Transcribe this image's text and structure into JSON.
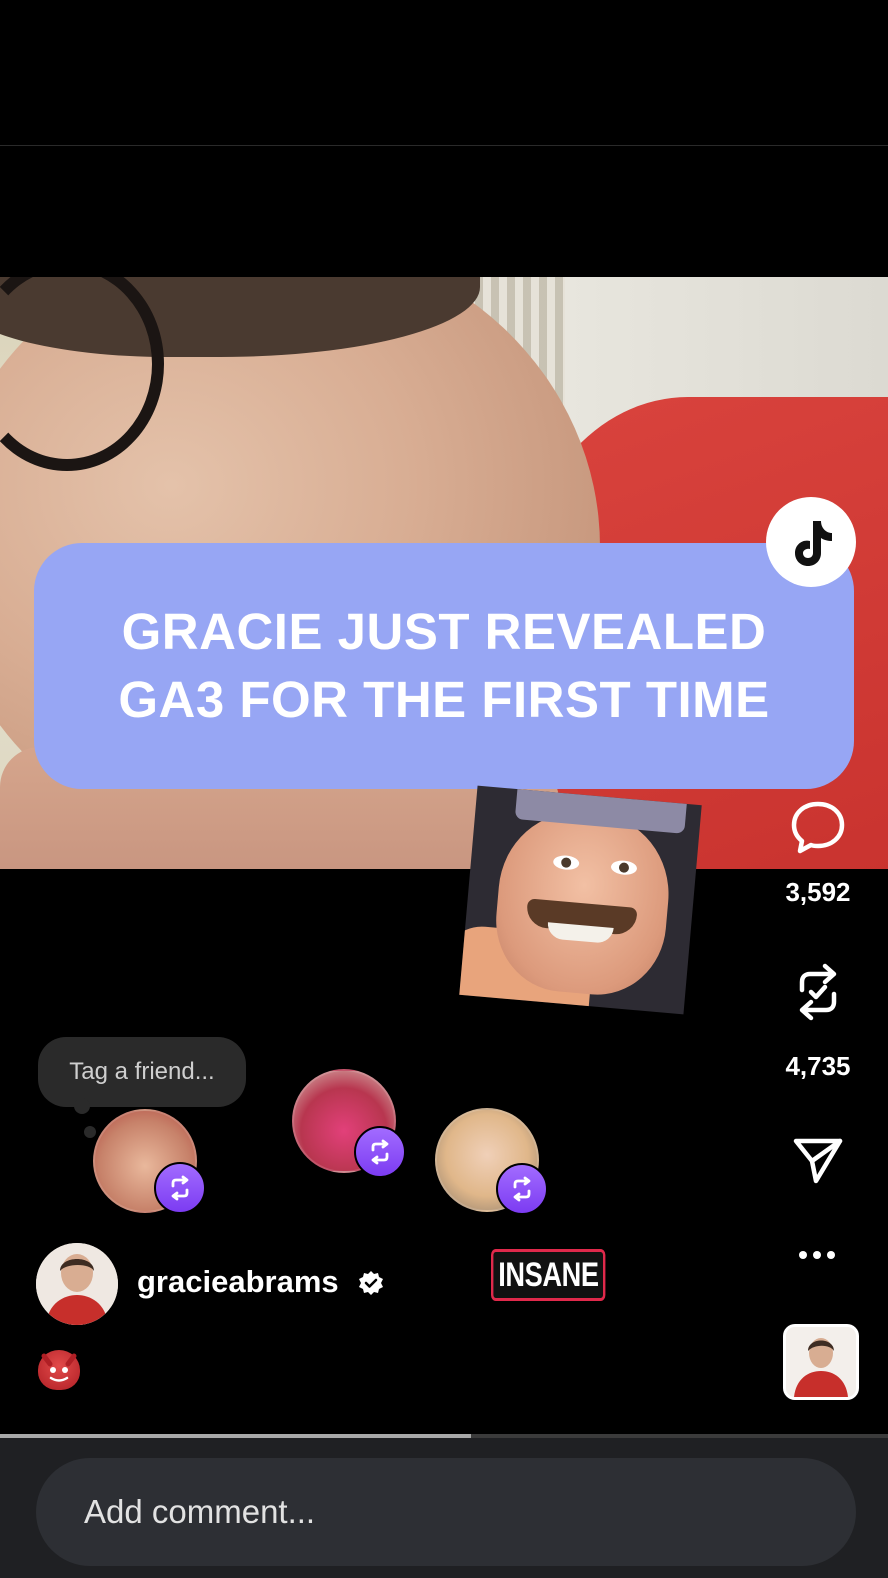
{
  "caption_banner": {
    "text": "GRACIE JUST REVEALED\nGA3 FOR THE FIRST TIME",
    "background": "#97a6f4"
  },
  "actions": {
    "comment_count": "3,592",
    "repost_count": "4,735"
  },
  "tag_prompt": "Tag a friend...",
  "post": {
    "username": "gracieabrams",
    "verified": true,
    "sticker_text": "INSANE",
    "caption_emoji": "devil-face"
  },
  "comment_input": {
    "placeholder": "Add comment..."
  },
  "playback": {
    "progress": 0.53
  },
  "colors": {
    "repost_badge": "#8b4dfa",
    "sticker_border": "#e0294b",
    "comment_bar_bg": "#1f2023"
  }
}
